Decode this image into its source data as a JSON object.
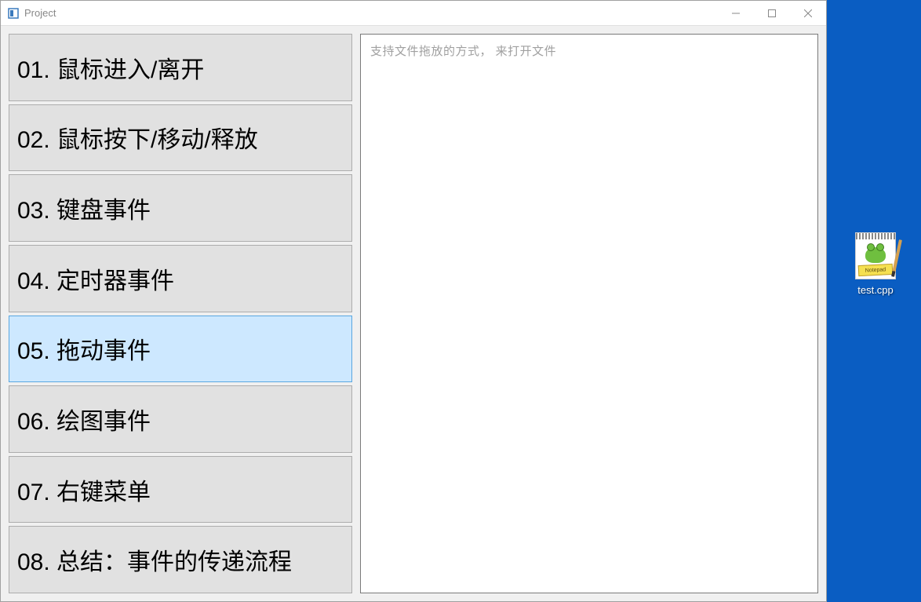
{
  "window": {
    "title": "Project"
  },
  "sidebar": {
    "items": [
      {
        "label": "01. 鼠标进入/离开",
        "selected": false
      },
      {
        "label": "02. 鼠标按下/移动/释放",
        "selected": false
      },
      {
        "label": "03. 键盘事件",
        "selected": false
      },
      {
        "label": "04. 定时器事件",
        "selected": false
      },
      {
        "label": "05. 拖动事件",
        "selected": true
      },
      {
        "label": "06. 绘图事件",
        "selected": false
      },
      {
        "label": "07. 右键菜单",
        "selected": false
      },
      {
        "label": "08. 总结：事件的传递流程",
        "selected": false
      }
    ]
  },
  "content": {
    "placeholder": "支持文件拖放的方式，  来打开文件"
  },
  "desktop": {
    "file_label": "test.cpp",
    "icon_banner": "Notepad"
  }
}
